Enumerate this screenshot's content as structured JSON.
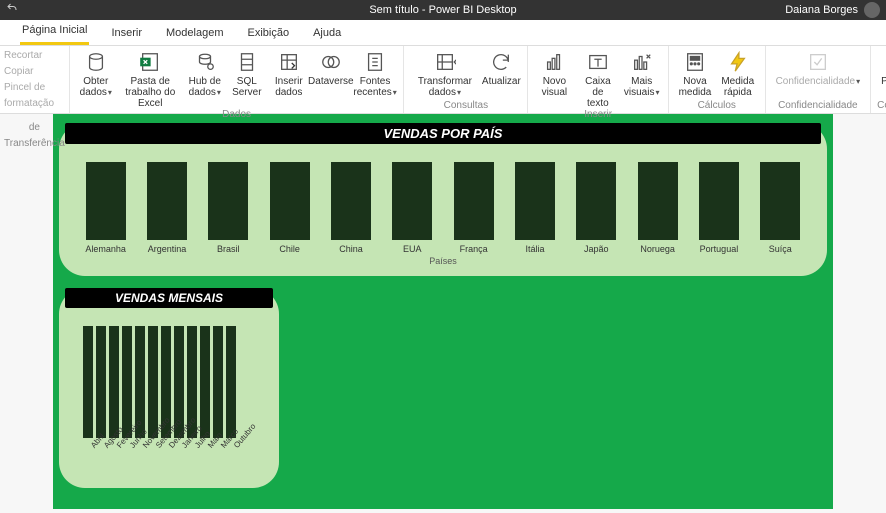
{
  "titlebar": {
    "title": "Sem título - Power BI Desktop",
    "user": "Daiana Borges"
  },
  "tabs": [
    "Página Inicial",
    "Inserir",
    "Modelagem",
    "Exibição",
    "Ajuda"
  ],
  "activeTab": 0,
  "clipboard": {
    "cut": "Recortar",
    "copy": "Copiar",
    "formatPainter": "Pincel de formatação",
    "group": "de Transferência"
  },
  "ribbon": {
    "dados": {
      "label": "Dados",
      "items": {
        "obter": "Obter dados",
        "excel": "Pasta de trabalho do Excel",
        "hub": "Hub de dados",
        "sql": "SQL Server",
        "inserir": "Inserir dados",
        "dataverse": "Dataverse",
        "recentes": "Fontes recentes"
      }
    },
    "consultas": {
      "label": "Consultas",
      "items": {
        "transformar": "Transformar dados",
        "atualizar": "Atualizar"
      }
    },
    "inserir": {
      "label": "Inserir",
      "items": {
        "visual": "Novo visual",
        "texto": "Caixa de texto",
        "mais": "Mais visuais"
      }
    },
    "calculos": {
      "label": "Cálculos",
      "items": {
        "medida": "Nova medida",
        "rapida": "Medida rápida"
      }
    },
    "conf": {
      "label": "Confidencialidade",
      "items": {
        "conf": "Confidencialidade"
      }
    },
    "compart": {
      "label": "Compartilhar",
      "items": {
        "publicar": "Publicar"
      }
    }
  },
  "chart_data": [
    {
      "type": "bar",
      "title": "VENDAS POR PAÍS",
      "xlabel": "Países",
      "categories": [
        "Alemanha",
        "Argentina",
        "Brasil",
        "Chile",
        "China",
        "EUA",
        "França",
        "Itália",
        "Japão",
        "Noruega",
        "Portugual",
        "Suíça"
      ],
      "values": [
        100,
        100,
        100,
        100,
        100,
        100,
        100,
        100,
        100,
        100,
        100,
        100
      ]
    },
    {
      "type": "bar",
      "title": "VENDAS MENSAIS",
      "categories": [
        "Abril",
        "Agosto",
        "Fevereiro",
        "Junho",
        "Novembro",
        "Setembro",
        "Dezembro",
        "Janeiro",
        "Julho",
        "Maio",
        "Março",
        "Outubro"
      ],
      "values": [
        100,
        100,
        100,
        100,
        100,
        100,
        100,
        100,
        100,
        100,
        100,
        100
      ]
    }
  ]
}
